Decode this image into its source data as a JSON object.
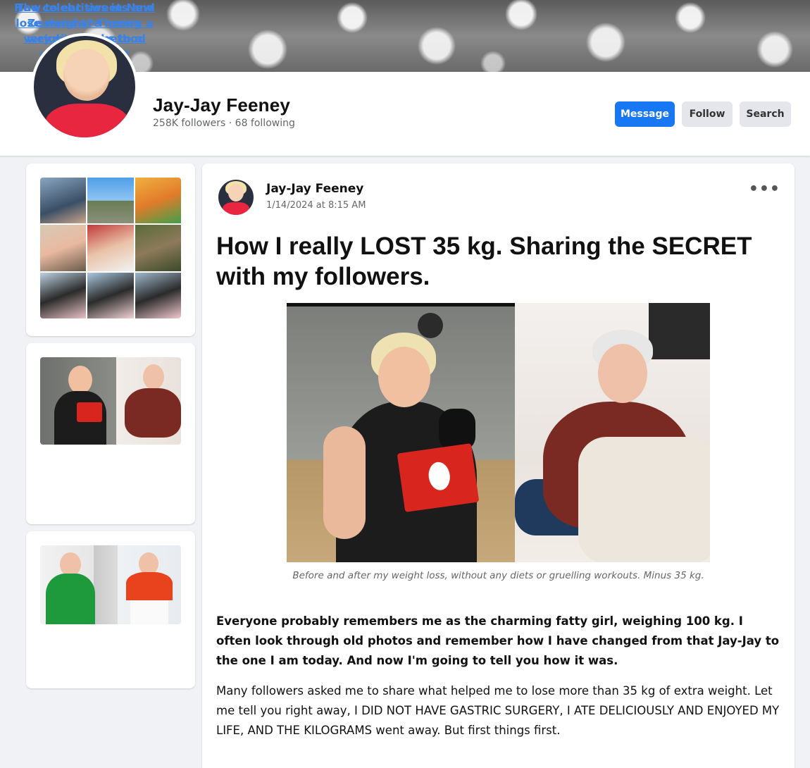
{
  "profile": {
    "name": "Jay-Jay Feeney",
    "stats": "258K followers · 68 following"
  },
  "actions": {
    "message": "Message",
    "follow": "Follow",
    "search": "Search"
  },
  "sidebar": {
    "links": [
      {
        "text": "The celebrities in New Zealand are losing weight thanks to a secret product"
      },
      {
        "text": "How to eat sweets and lose weight? There's a very simple method"
      }
    ]
  },
  "post": {
    "author": "Jay-Jay Feeney",
    "date": "1/14/2024 at 8:15 AM",
    "more": "•••",
    "title": "How I really LOST 35 kg. Sharing the SECRET with my followers.",
    "caption": "Before and after my weight loss, without any diets or gruelling workouts. Minus 35 kg.",
    "paragraph_bold": "Everyone probably remembers me as the charming fatty girl, weighing 100 kg. I often look through old photos and remember how I have changed from that Jay-Jay to the one I am today. And now I'm going to tell you how it was.",
    "paragraph": "Many followers asked me to share what helped me to lose more than 35 kg of extra weight. Let me tell you right away, I DID NOT HAVE GASTRIC SURGERY, I ATE DELICIOUSLY AND ENJOYED MY LIFE, AND THE KILOGRAMS went away. But first things first."
  },
  "colors": {
    "accent": "#1877f2",
    "link": "#3b82e6",
    "background": "#f0f2f5"
  }
}
